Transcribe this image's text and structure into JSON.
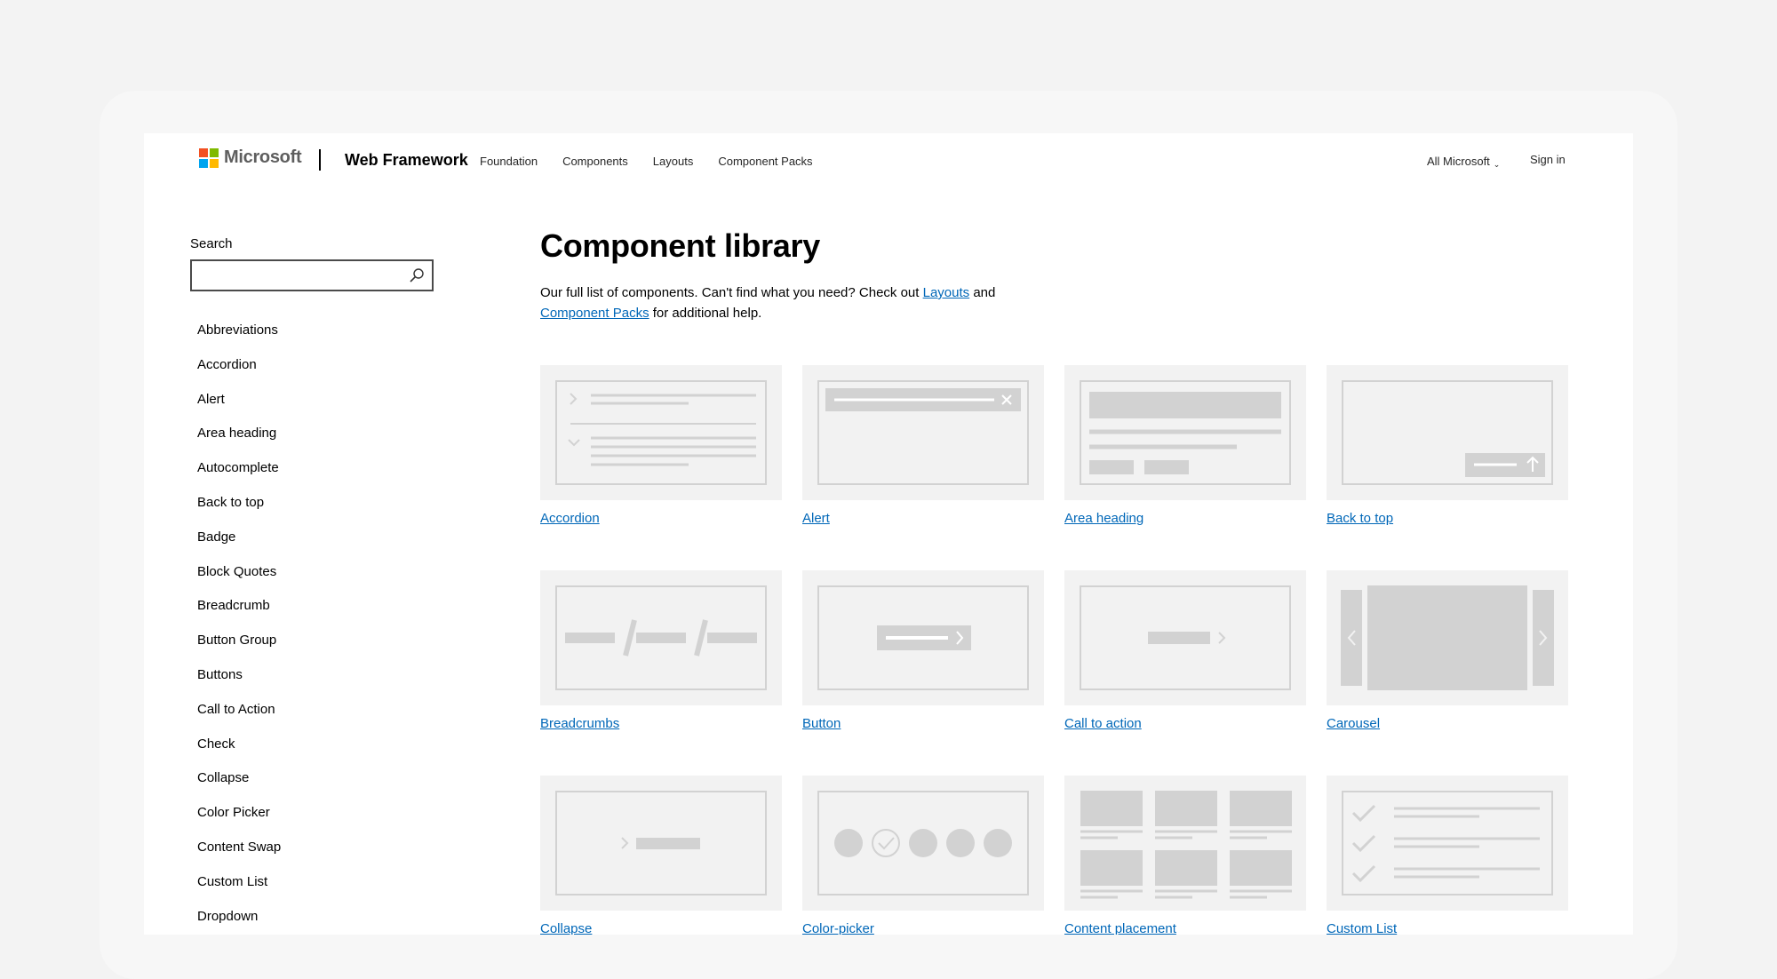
{
  "header": {
    "logo_text": "Microsoft",
    "logo_colors": [
      "#f25022",
      "#7fba00",
      "#00a4ef",
      "#ffb900"
    ],
    "brand": "Web Framework",
    "nav": [
      "Foundation",
      "Components",
      "Layouts",
      "Component Packs"
    ],
    "all_microsoft": "All Microsoft",
    "sign_in": "Sign in"
  },
  "sidebar": {
    "search_label": "Search",
    "search_value": "",
    "items": [
      "Abbreviations",
      "Accordion",
      "Alert",
      "Area heading",
      "Autocomplete",
      "Back to top",
      "Badge",
      "Block Quotes",
      "Breadcrumb",
      "Button Group",
      "Buttons",
      "Call to Action",
      "Check",
      "Collapse",
      "Color Picker",
      "Content Swap",
      "Custom List",
      "Dropdown"
    ]
  },
  "main": {
    "title": "Component library",
    "intro_text_1": "Our full list of components. Can't find what you need? Check out ",
    "intro_link_1": "Layouts",
    "intro_text_2": " and ",
    "intro_link_2": "Component Packs",
    "intro_text_3": " for additional help.",
    "cards": [
      "Accordion",
      "Alert",
      "Area heading",
      "Back to top",
      "Breadcrumbs",
      "Button",
      "Call to action",
      "Carousel",
      "Collapse",
      "Color-picker",
      "Content placement",
      "Custom List"
    ]
  },
  "colors": {
    "link": "#0067b8",
    "thumb_bg": "#f2f2f2",
    "thumb_stroke": "#d2d2d2"
  }
}
